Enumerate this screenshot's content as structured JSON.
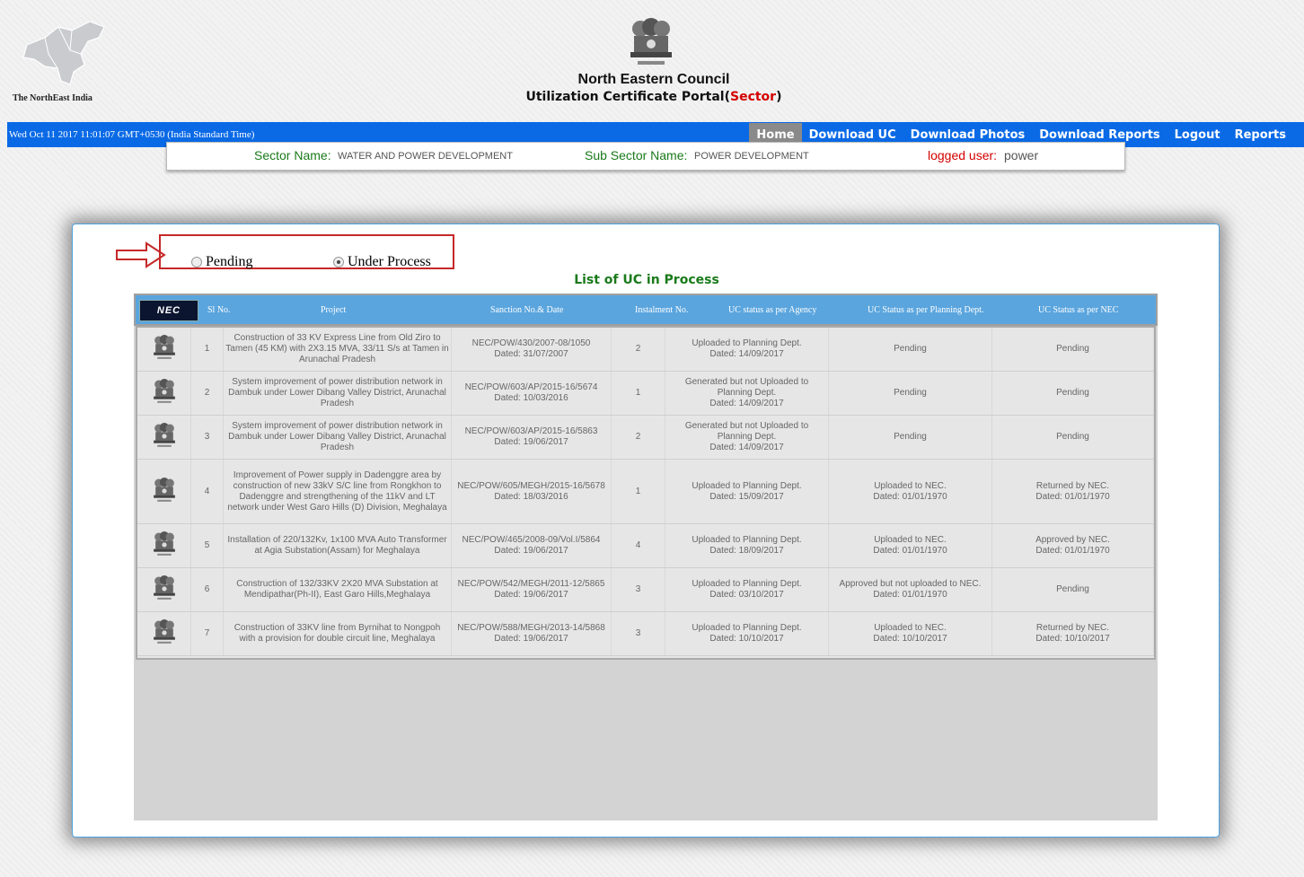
{
  "header": {
    "logo_caption": "The NorthEast India",
    "title": "North Eastern Council",
    "subtitle_prefix": "Utilization Certificate Portal(",
    "subtitle_highlight": "Sector",
    "subtitle_suffix": ")"
  },
  "navbar": {
    "datetime": "Wed Oct 11 2017 11:01:07 GMT+0530 (India Standard Time)",
    "items": [
      {
        "label": "Home",
        "active": true
      },
      {
        "label": "Download UC",
        "active": false
      },
      {
        "label": "Download Photos",
        "active": false
      },
      {
        "label": "Download Reports",
        "active": false
      },
      {
        "label": "Logout",
        "active": false
      },
      {
        "label": "Reports",
        "active": false
      }
    ]
  },
  "sector_bar": {
    "sector_label": "Sector Name:",
    "sector_value": "WATER AND POWER DEVELOPMENT",
    "subsector_label": "Sub Sector Name:",
    "subsector_value": "POWER DEVELOPMENT",
    "user_label": "logged user:",
    "user_value": "power"
  },
  "filter": {
    "options": [
      {
        "label": "Pending",
        "checked": false
      },
      {
        "label": "Under Process",
        "checked": true
      }
    ]
  },
  "list_title": "List of UC in Process",
  "table": {
    "logo_text": "NEC",
    "columns": [
      "Sl No.",
      "Project",
      "Sanction No.& Date",
      "Instalment No.",
      "UC status as per Agency",
      "UC Status as per Planning Dept.",
      "UC Status as per NEC"
    ],
    "rows": [
      {
        "sl": "1",
        "project": "Construction of 33 KV Express Line from Old Ziro to Tamen (45 KM) with 2X3.15 MVA, 33/11 S/s at Tamen in Arunachal Pradesh",
        "sanction": "NEC/POW/430/2007-08/1050\nDated: 31/07/2007",
        "instalment": "2",
        "agency": "Uploaded to Planning Dept.\nDated: 14/09/2017",
        "planning": "Pending",
        "nec": "Pending"
      },
      {
        "sl": "2",
        "project": "System improvement of power distribution network in Dambuk under Lower Dibang Valley District, Arunachal Pradesh",
        "sanction": "NEC/POW/603/AP/2015-16/5674\nDated: 10/03/2016",
        "instalment": "1",
        "agency": "Generated but not Uploaded to Planning Dept.\nDated: 14/09/2017",
        "planning": "Pending",
        "nec": "Pending"
      },
      {
        "sl": "3",
        "project": "System improvement of power distribution network in Dambuk under Lower Dibang Valley District, Arunachal Pradesh",
        "sanction": "NEC/POW/603/AP/2015-16/5863\nDated: 19/06/2017",
        "instalment": "2",
        "agency": "Generated but not Uploaded to Planning Dept.\nDated: 14/09/2017",
        "planning": "Pending",
        "nec": "Pending"
      },
      {
        "sl": "4",
        "project": "Improvement of Power supply in Dadenggre area by construction of new 33kV S/C line from Rongkhon to Dadenggre and strengthening of the 11kV and LT network under West Garo Hills (D) Division, Meghalaya",
        "sanction": "NEC/POW/605/MEGH/2015-16/5678\nDated: 18/03/2016",
        "instalment": "1",
        "agency": "Uploaded to Planning Dept.\nDated: 15/09/2017",
        "planning": "Uploaded to NEC.\nDated: 01/01/1970",
        "nec": "Returned by NEC.\nDated: 01/01/1970"
      },
      {
        "sl": "5",
        "project": "Installation of 220/132Kv, 1x100 MVA Auto Transformer at Agia Substation(Assam) for Meghalaya",
        "sanction": "NEC/POW/465/2008-09/Vol.I/5864\nDated: 19/06/2017",
        "instalment": "4",
        "agency": "Uploaded to Planning Dept.\nDated: 18/09/2017",
        "planning": "Uploaded to NEC.\nDated: 01/01/1970",
        "nec": "Approved by NEC.\nDated: 01/01/1970"
      },
      {
        "sl": "6",
        "project": "Construction of 132/33KV 2X20 MVA Substation at Mendipathar(Ph-II), East Garo Hills,Meghalaya",
        "sanction": "NEC/POW/542/MEGH/2011-12/5865\nDated: 19/06/2017",
        "instalment": "3",
        "agency": "Uploaded to Planning Dept.\nDated: 03/10/2017",
        "planning": "Approved but not uploaded to NEC.\nDated: 01/01/1970",
        "nec": "Pending"
      },
      {
        "sl": "7",
        "project": "Construction of 33KV line from Byrnihat to Nongpoh with a provision for double circuit line, Meghalaya",
        "sanction": "NEC/POW/588/MEGH/2013-14/5868\nDated: 19/06/2017",
        "instalment": "3",
        "agency": "Uploaded to Planning Dept.\nDated: 10/10/2017",
        "planning": "Uploaded to NEC.\nDated: 10/10/2017",
        "nec": "Returned by NEC.\nDated: 10/10/2017"
      }
    ]
  }
}
